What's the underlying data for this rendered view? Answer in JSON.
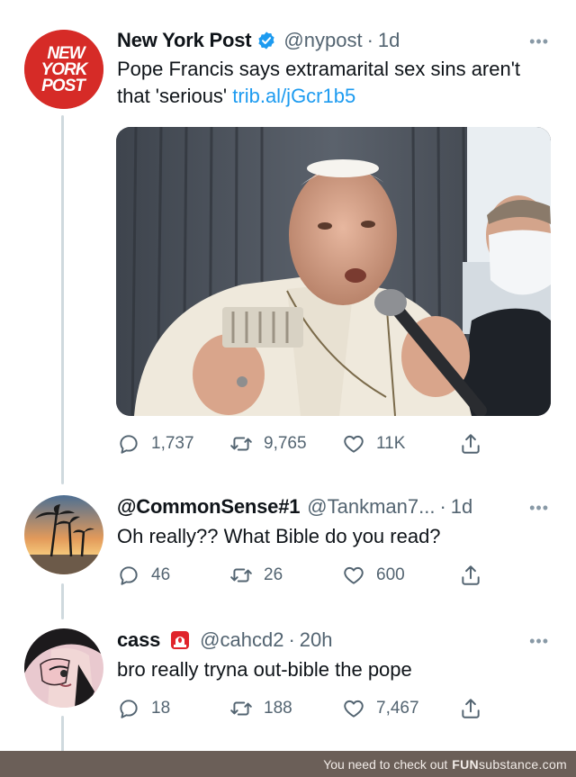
{
  "tweets": [
    {
      "name": "New York Post",
      "verified": true,
      "handle": "@nypost",
      "time": "1d",
      "text": "Pope Francis says extramarital sex sins aren't that 'serious'",
      "link": "trib.al/jGcr1b5",
      "avatar_logo": [
        "NEW",
        "YORK",
        "POST"
      ],
      "replies": "1,737",
      "retweets": "9,765",
      "likes": "11K"
    },
    {
      "name": "@CommonSense#1",
      "handle": "@Tankman7...",
      "time": "1d",
      "text": "Oh really?? What Bible do you read?",
      "replies": "46",
      "retweets": "26",
      "likes": "600"
    },
    {
      "name": "cass",
      "name_badge_icon": "siren-emoji",
      "handle": "@cahcd2",
      "time": "20h",
      "text": "bro really tryna out-bible the pope",
      "replies": "18",
      "retweets": "188",
      "likes": "7,467"
    }
  ],
  "dot": "·",
  "more": "•••",
  "footer": {
    "text": "You need to check out",
    "brand_a": "FUN",
    "brand_b": "substance.com"
  },
  "colors": {
    "link": "#1d9bf0",
    "muted": "#536471",
    "nypost_red": "#d62b27",
    "verified_blue": "#1d9bf0",
    "footer_bg": "#6b5f58"
  }
}
